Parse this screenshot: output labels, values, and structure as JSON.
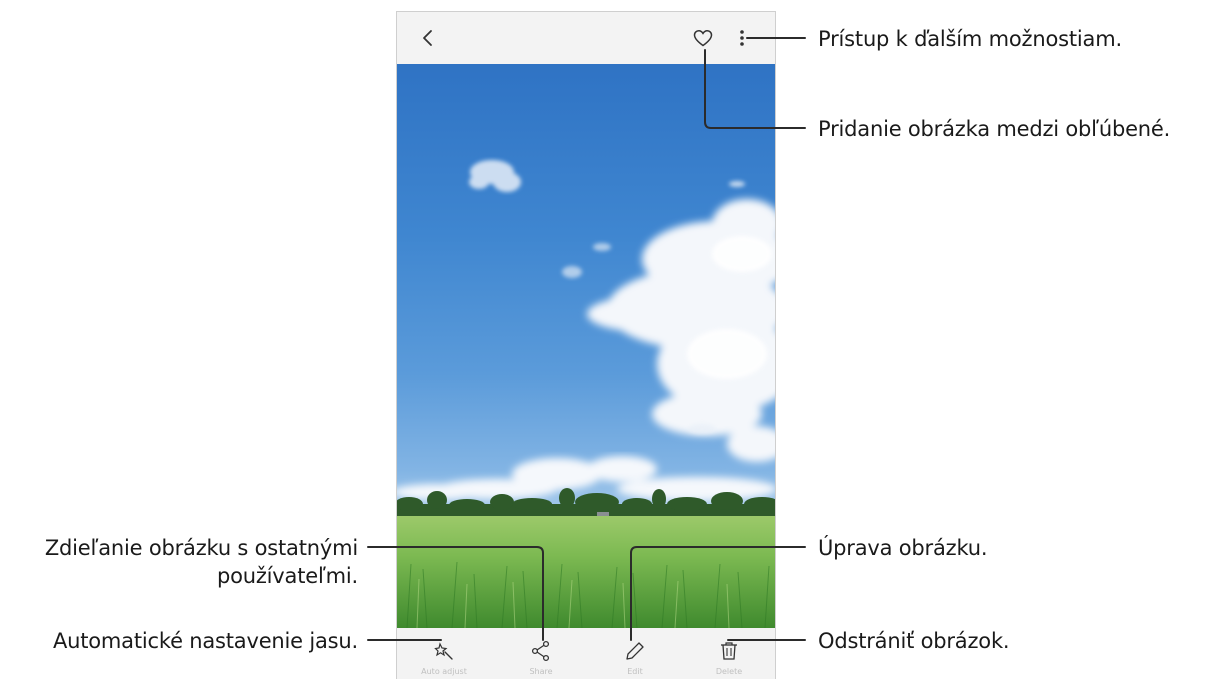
{
  "tools": [
    {
      "label": "Auto adjust",
      "icon": "auto-adjust-icon"
    },
    {
      "label": "Share",
      "icon": "share-icon"
    },
    {
      "label": "Edit",
      "icon": "edit-pencil-icon"
    },
    {
      "label": "Delete",
      "icon": "trash-icon"
    }
  ],
  "appbar": {
    "back_icon": "back-arrow-icon",
    "favorite_icon": "heart-icon",
    "more_icon": "more-options-icon"
  },
  "callouts": {
    "more_options": "Prístup k ďalším možnostiam.",
    "favorite": "Pridanie obrázka medzi obľúbené.",
    "share_line1": "Zdieľanie obrázku s ostatnými",
    "share_line2": "používateľmi.",
    "edit": "Úprava obrázku.",
    "auto_adjust": "Automatické nastavenie jasu.",
    "delete": "Odstrániť obrázok."
  },
  "colors": {
    "callout_line": "#2b2b2b",
    "bar_bg": "#f3f3f3",
    "sky": "#3f86d0",
    "grass": "#6fb04a"
  }
}
